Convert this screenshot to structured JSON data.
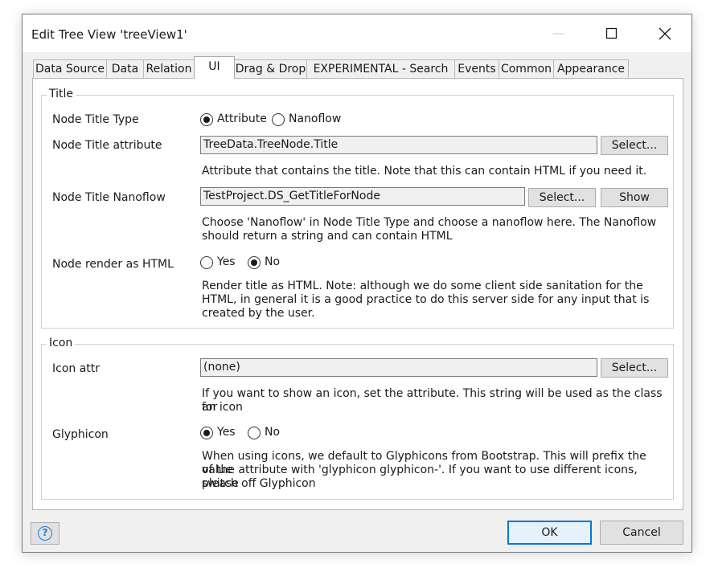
{
  "window": {
    "title": "Edit Tree View 'treeView1'"
  },
  "tabs": [
    {
      "label": "Data Source"
    },
    {
      "label": "Data"
    },
    {
      "label": "Relation"
    },
    {
      "label": "UI"
    },
    {
      "label": "Drag & Drop"
    },
    {
      "label": "EXPERIMENTAL - Search"
    },
    {
      "label": "Events"
    },
    {
      "label": "Common"
    },
    {
      "label": "Appearance"
    }
  ],
  "active_tab": "UI",
  "title_group": {
    "legend": "Title",
    "node_title_type": {
      "label": "Node Title Type",
      "options": [
        "Attribute",
        "Nanoflow"
      ],
      "selected": "Attribute"
    },
    "node_title_attribute": {
      "label": "Node Title attribute",
      "value": "TreeData.TreeNode.Title",
      "select_label": "Select...",
      "help": "Attribute that contains the title. Note that this can contain HTML if you need it."
    },
    "node_title_nanoflow": {
      "label": "Node Title Nanoflow",
      "value": "TestProject.DS_GetTitleForNode",
      "select_label": "Select...",
      "show_label": "Show",
      "help_line1": "Choose 'Nanoflow' in Node Title Type and choose a nanoflow here. The Nanoflow",
      "help_line2": "should return a string and can contain HTML"
    },
    "node_render_html": {
      "label": "Node render as HTML",
      "options": [
        "Yes",
        "No"
      ],
      "selected": "No",
      "help_line1": "Render title as HTML. Note: although we do some client side sanitation for the",
      "help_line2": "HTML, in general it is a good practice to do this server side for any input that is",
      "help_line3": "created by the user."
    }
  },
  "icon_group": {
    "legend": "Icon",
    "icon_attr": {
      "label": "Icon attr",
      "value": "(none)",
      "select_label": "Select...",
      "help_line1": "If you want to show an icon, set the attribute. This string will be used as the class for",
      "help_line2": "an icon"
    },
    "glyphicon": {
      "label": "Glyphicon",
      "options": [
        "Yes",
        "No"
      ],
      "selected": "Yes",
      "help_line1": "When using icons, we default to Glyphicons from Bootstrap. This will prefix the value",
      "help_line2": "of the attribute with 'glyphicon glyphicon-'. If you want to use different icons, please",
      "help_line3": "switch off Glyphicon"
    }
  },
  "footer": {
    "help_icon": "question-circle-icon",
    "ok_label": "OK",
    "cancel_label": "Cancel"
  },
  "colors": {
    "accent": "#0078d7",
    "help_icon": "#1b7ed6",
    "dialog_bg": "#f0f0f0"
  }
}
